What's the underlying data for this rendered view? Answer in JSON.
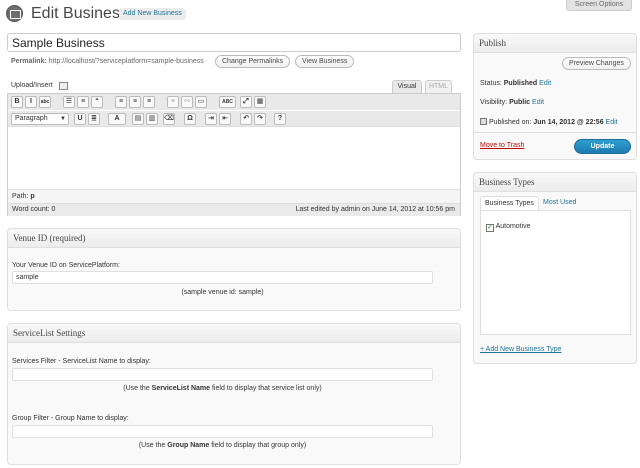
{
  "header": {
    "title": "Edit Business",
    "add_new_label": "Add New Business",
    "screen_options_label": "Screen Options"
  },
  "post": {
    "title": "Sample Business",
    "permalink_label": "Permalink:",
    "permalink_url": "http://localhost/?serviceplatform=sample-business",
    "change_permalinks_label": "Change Permalinks",
    "view_label": "View Business"
  },
  "editor": {
    "upload_insert_label": "Upload/Insert",
    "tab_visual": "Visual",
    "tab_html": "HTML",
    "format_select_value": "Paragraph",
    "path_label": "Path:",
    "path_value": "p",
    "word_count": "Word count: 0",
    "last_edited": "Last edited by admin on June 14, 2012 at 10:56 pm",
    "row1_buttons": [
      {
        "glyph": "B",
        "name": "bold-icon"
      },
      {
        "glyph": "I",
        "name": "italic-icon"
      },
      {
        "glyph": "abc",
        "name": "strikethrough-icon"
      },
      {
        "glyph": "☰",
        "name": "bullet-list-icon"
      },
      {
        "glyph": "≡",
        "name": "numbered-list-icon"
      },
      {
        "glyph": "“",
        "name": "blockquote-icon"
      },
      {
        "glyph": "≡",
        "name": "align-left-icon"
      },
      {
        "glyph": "≡",
        "name": "align-center-icon"
      },
      {
        "glyph": "≡",
        "name": "align-right-icon"
      },
      {
        "glyph": "⚭",
        "name": "insert-link-icon"
      },
      {
        "glyph": "⚯",
        "name": "unlink-icon"
      },
      {
        "glyph": "▭",
        "name": "insert-more-icon"
      },
      {
        "glyph": "ABC",
        "name": "spellcheck-icon"
      },
      {
        "glyph": "⤢",
        "name": "fullscreen-icon"
      },
      {
        "glyph": "▦",
        "name": "kitchen-sink-icon"
      }
    ],
    "row2_buttons": [
      {
        "glyph": "U",
        "name": "underline-icon"
      },
      {
        "glyph": "≣",
        "name": "justify-icon"
      },
      {
        "glyph": "A",
        "name": "text-color-icon"
      },
      {
        "glyph": "▤",
        "name": "paste-text-icon"
      },
      {
        "glyph": "▥",
        "name": "paste-word-icon"
      },
      {
        "glyph": "⌫",
        "name": "remove-formatting-icon"
      },
      {
        "glyph": "Ω",
        "name": "special-character-icon"
      },
      {
        "glyph": "⇥",
        "name": "outdent-icon"
      },
      {
        "glyph": "⇤",
        "name": "indent-icon"
      },
      {
        "glyph": "↶",
        "name": "undo-icon"
      },
      {
        "glyph": "↷",
        "name": "redo-icon"
      },
      {
        "glyph": "?",
        "name": "help-icon"
      }
    ]
  },
  "venue_box": {
    "title": "Venue ID (required)",
    "field_label": "Your Venue ID on ServicePlatform:",
    "field_value": "sample",
    "hint": "(sample venue id: sample)"
  },
  "servicelist_box": {
    "title": "ServiceList Settings",
    "services_label": "Services Filter - ServiceList Name to display:",
    "services_value": "",
    "services_hint_pre": "(Use the ",
    "services_hint_bold": "ServiceList Name",
    "services_hint_post": " field to display that service list only)",
    "group_label": "Group Filter - Group Name to display:",
    "group_value": "",
    "group_hint_pre": "(Use the ",
    "group_hint_bold": "Group Name",
    "group_hint_post": " field to display that group only)"
  },
  "publish_box": {
    "title": "Publish",
    "preview_label": "Preview Changes",
    "status_label": "Status:",
    "status_value": "Published",
    "visibility_label": "Visibility:",
    "visibility_value": "Public",
    "published_label": "Published on:",
    "published_value": "Jun 14, 2012 @ 22:56",
    "edit_label": "Edit",
    "trash_label": "Move to Trash",
    "update_label": "Update"
  },
  "business_types_box": {
    "title": "Business Types",
    "tab_all": "Business Types",
    "tab_most_used": "Most Used",
    "items": [
      {
        "label": "Automotive",
        "checked": true
      }
    ],
    "add_new_label": "+ Add New Business Type"
  }
}
